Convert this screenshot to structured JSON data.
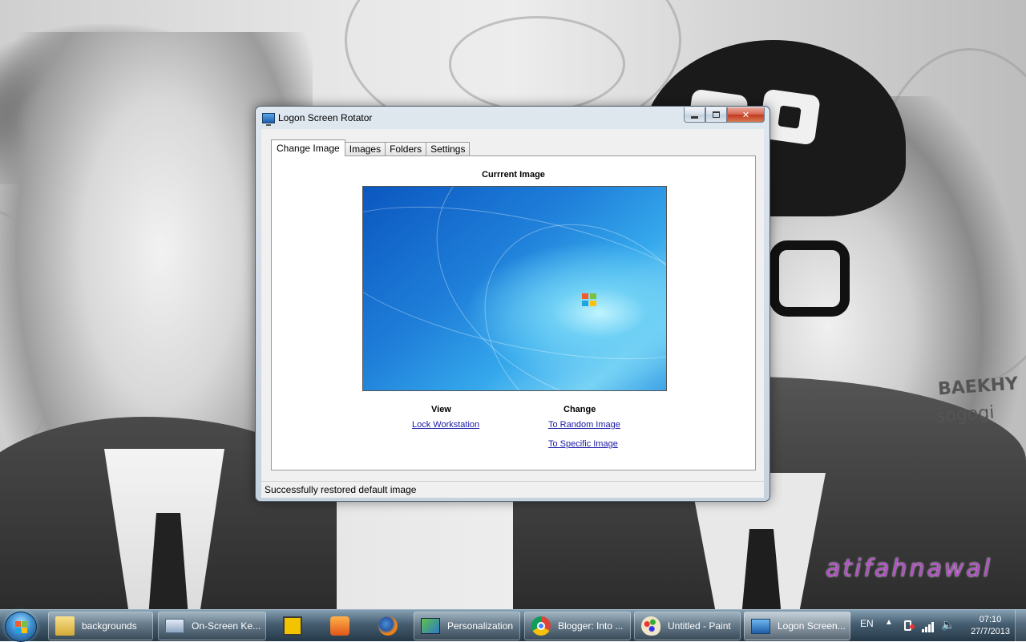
{
  "desktop": {
    "wall_text_1": "BAEKHY",
    "wall_text_2": "sogogi",
    "watermark": "atifahnawal"
  },
  "window": {
    "title": "Logon Screen Rotator",
    "tabs": [
      "Change Image",
      "Images",
      "Folders",
      "Settings"
    ],
    "active_tab": "Change Image",
    "current_image_label": "Currrent Image",
    "view": {
      "heading": "View",
      "lock_link": "Lock Workstation"
    },
    "change": {
      "heading": "Change",
      "random_link": "To Random Image",
      "specific_link": "To Specific Image"
    },
    "status": "Successfully restored default image"
  },
  "taskbar": {
    "items": [
      {
        "label": "backgrounds",
        "icon": "folder-icon"
      },
      {
        "label": "On-Screen Ke...",
        "icon": "keyboard-icon"
      },
      {
        "label": "",
        "icon": "slides-app-icon"
      },
      {
        "label": "",
        "icon": "media-player-icon"
      },
      {
        "label": "",
        "icon": "firefox-icon"
      },
      {
        "label": "Personalization",
        "icon": "personalization-icon"
      },
      {
        "label": "Blogger: Into ...",
        "icon": "chrome-icon"
      },
      {
        "label": "Untitled - Paint",
        "icon": "paint-icon"
      },
      {
        "label": "Logon Screen...",
        "icon": "monitor-icon"
      }
    ],
    "language": "EN",
    "time": "07:10",
    "date": "27/7/2013"
  },
  "colors": {
    "link": "#1a1aa6",
    "watermark": "#b24fc5",
    "close_button": "#c2391f"
  }
}
